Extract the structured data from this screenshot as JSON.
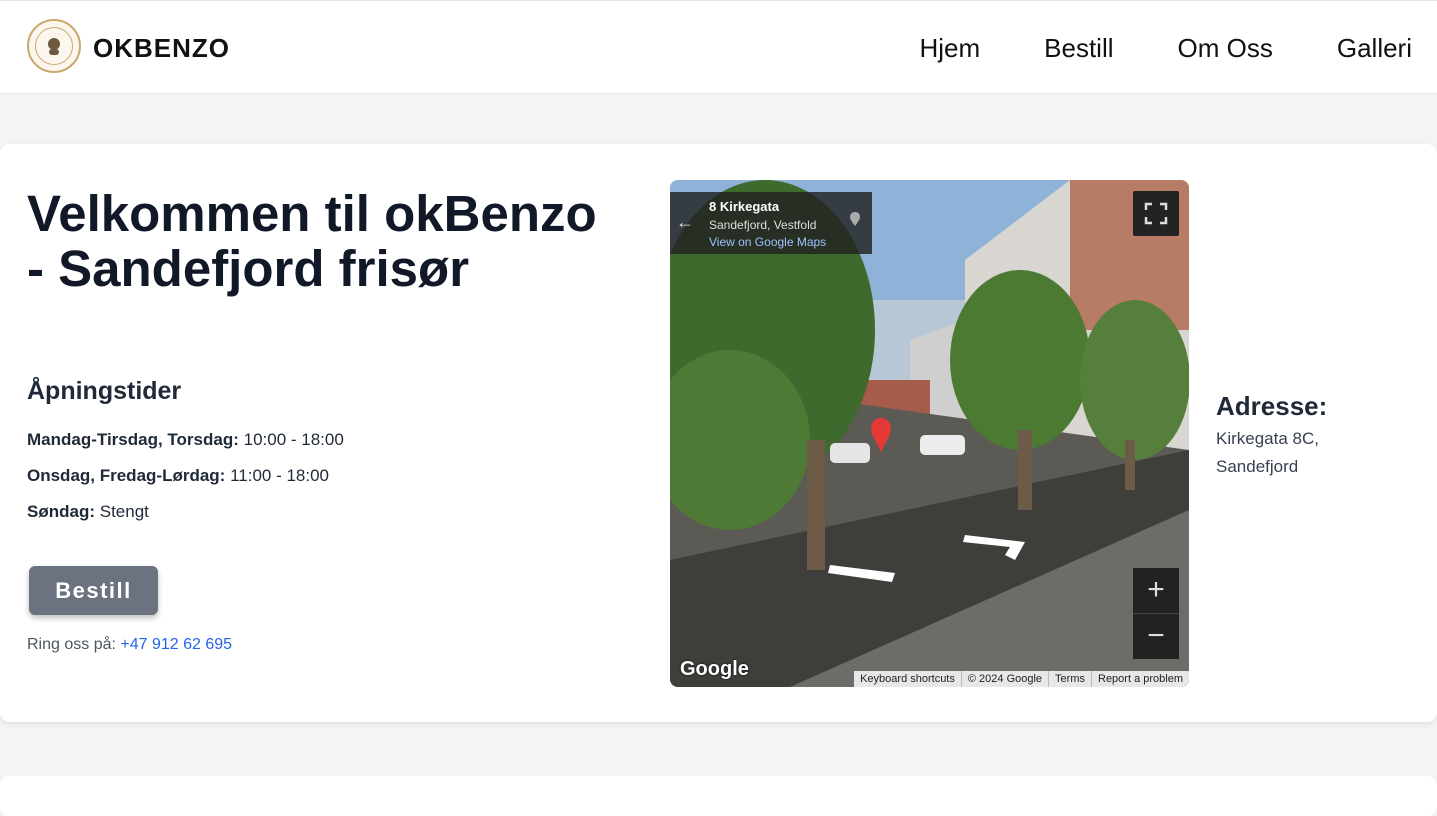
{
  "header": {
    "brand": "OKBENZO",
    "nav": [
      "Hjem",
      "Bestill",
      "Om Oss",
      "Galleri"
    ]
  },
  "hero": {
    "title": "Velkommen til okBenzo - Sandefjord frisør",
    "hours_title": "Åpningstider",
    "hours": [
      {
        "label": "Mandag-Tirsdag, Torsdag:",
        "value": "10:00 - 18:00"
      },
      {
        "label": "Onsdag, Fredag-Lørdag:",
        "value": "11:00 - 18:00"
      },
      {
        "label": "Søndag:",
        "value": "Stengt"
      }
    ],
    "book_button": "Bestill",
    "call_prefix": "Ring oss på:",
    "phone": "+47 912 62 695"
  },
  "map": {
    "street": "8 Kirkegata",
    "region": "Sandefjord, Vestfold",
    "link": "View on Google Maps",
    "zoom_in": "+",
    "zoom_out": "−",
    "logo": "Google",
    "attribution": [
      "Keyboard shortcuts",
      "© 2024 Google",
      "Terms",
      "Report a problem"
    ]
  },
  "address": {
    "title": "Adresse:",
    "text": "Kirkegata 8C, Sandefjord"
  }
}
